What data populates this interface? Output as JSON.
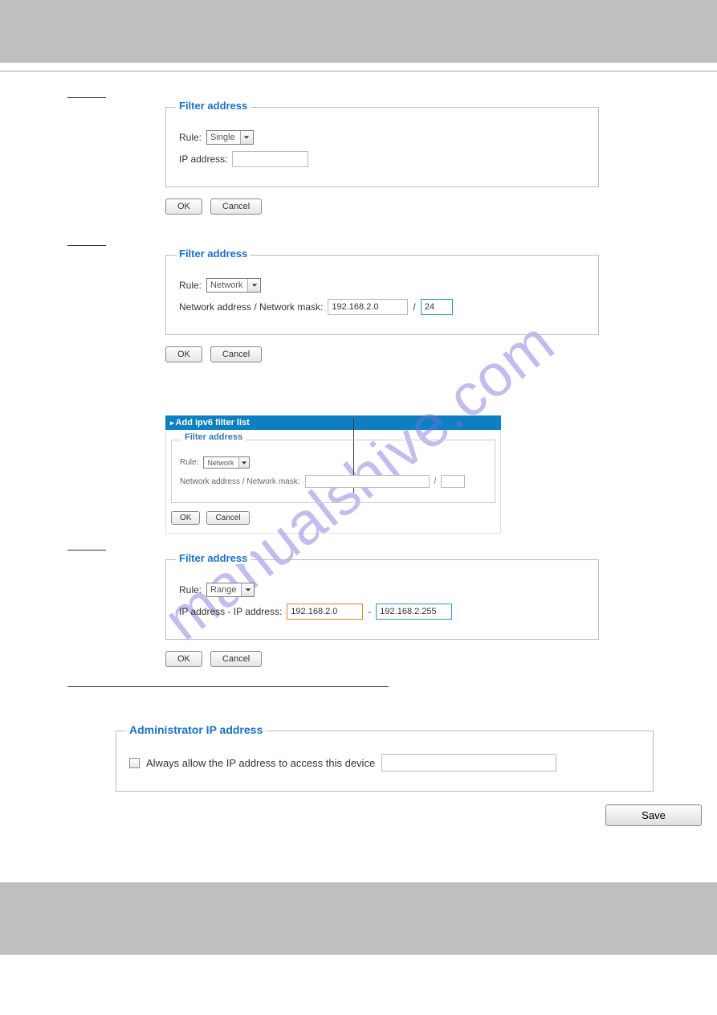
{
  "watermark": "manualshive.com",
  "sections": {
    "single": {
      "legend": "Filter address",
      "rule_label": "Rule:",
      "rule_value": "Single",
      "ip_label": "IP address:",
      "ip_value": "",
      "ok": "OK",
      "cancel": "Cancel"
    },
    "network_v4": {
      "legend": "Filter address",
      "rule_label": "Rule:",
      "rule_value": "Network",
      "mask_label": "Network address / Network mask:",
      "addr_value": "192.168.2.0",
      "slash": "/",
      "mask_value": "24",
      "ok": "OK",
      "cancel": "Cancel"
    },
    "ipv6": {
      "bar_title": "Add ipv6 filter list",
      "legend": "Filter address",
      "rule_label": "Rule:",
      "rule_value": "Network",
      "mask_label": "Network address / Network mask:",
      "addr_value": "",
      "slash": "/",
      "mask_value": "",
      "ok": "OK",
      "cancel": "Cancel"
    },
    "range": {
      "legend": "Filter address",
      "rule_label": "Rule:",
      "rule_value": "Range",
      "range_label": "IP address - IP address:",
      "from_value": "192.168.2.0",
      "dash": "-",
      "to_value": "192.168.2.255",
      "ok": "OK",
      "cancel": "Cancel"
    },
    "admin": {
      "legend": "Administrator IP address",
      "checkbox_label": "Always allow the IP address to access this device",
      "ip_value": "",
      "save": "Save"
    }
  }
}
